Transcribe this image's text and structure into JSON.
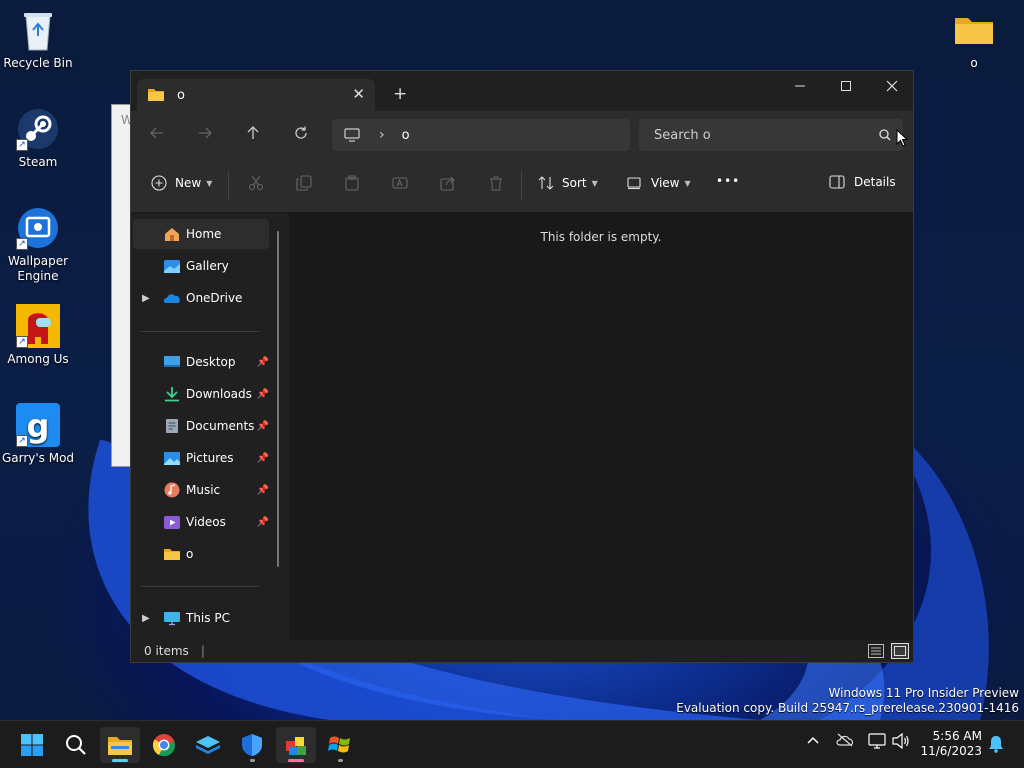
{
  "desktop": {
    "icons": [
      {
        "label": "Recycle Bin",
        "icon": "recycle-bin-icon"
      },
      {
        "label": "Steam",
        "icon": "steam-icon"
      },
      {
        "label": "Wallpaper Engine",
        "icon": "wallpaper-engine-icon"
      },
      {
        "label": "Among Us",
        "icon": "among-us-icon"
      },
      {
        "label": "Garry's Mod",
        "icon": "garrys-mod-icon"
      },
      {
        "label": "o",
        "icon": "folder-icon"
      }
    ],
    "bg_window_letter": "W"
  },
  "explorer": {
    "tab_title": "o",
    "tab_close": "✕",
    "new_tab": "+",
    "breadcrumb": {
      "separator": "›",
      "folder": "o"
    },
    "search_placeholder": "Search o",
    "toolbar": {
      "new_label": "New",
      "sort_label": "Sort",
      "view_label": "View",
      "more_label": "•••",
      "details_label": "Details"
    },
    "sidebar": {
      "home": "Home",
      "gallery": "Gallery",
      "onedrive": "OneDrive",
      "desktop": "Desktop",
      "downloads": "Downloads",
      "documents": "Documents",
      "pictures": "Pictures",
      "music": "Music",
      "videos": "Videos",
      "folder_o": "o",
      "this_pc": "This PC"
    },
    "empty_message": "This folder is empty.",
    "status_items": "0 items"
  },
  "watermark": {
    "line1": "Windows 11 Pro Insider Preview",
    "line2": "Evaluation copy. Build 25947.rs_prerelease.230901-1416"
  },
  "taskbar": {
    "time": "5:56 AM",
    "date": "11/6/2023"
  },
  "colors": {
    "accent": "#60cdff",
    "window_bg": "#191919",
    "toolbar_bg": "#2c2c2c",
    "folder_yellow": "#f7c548"
  }
}
